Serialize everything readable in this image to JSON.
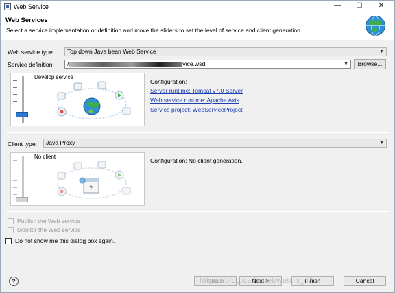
{
  "window": {
    "title": "Web Service",
    "minimize_glyph": "—",
    "maximize_glyph": "☐",
    "close_glyph": "✕"
  },
  "banner": {
    "heading": "Web Services",
    "description": "Select a service implementation or definition and move the sliders to set the level of service and client generation.",
    "icon": "web-service-globe-icon"
  },
  "service": {
    "type_label": "Web service type:",
    "type_value": "Top down Java bean Web Service",
    "definition_label": "Service definition:",
    "definition_prefix": "/",
    "definition_suffix": "vice.wsdl",
    "browse_label": "Browse...",
    "level_caption": "Develop service",
    "config_title": "Configuration:",
    "links": [
      "Server runtime: Tomcat v7.0 Server",
      "Web service runtime: Apache Axis",
      "Service project: WebServiceProject"
    ]
  },
  "client": {
    "type_label": "Client type:",
    "type_value": "Java Proxy",
    "level_caption": "No client",
    "config_text": "Configuration: No client generation."
  },
  "options": {
    "publish": "Publish the Web service",
    "monitor": "Monitor the Web service",
    "dont_show": "Do not show me this dialog box again."
  },
  "footer": {
    "help_glyph": "?",
    "back": "< Back",
    "next": "Next >",
    "finish": "Finish",
    "cancel": "Cancel"
  },
  "watermark": "https://blog.csdn.net/weixin_42..."
}
